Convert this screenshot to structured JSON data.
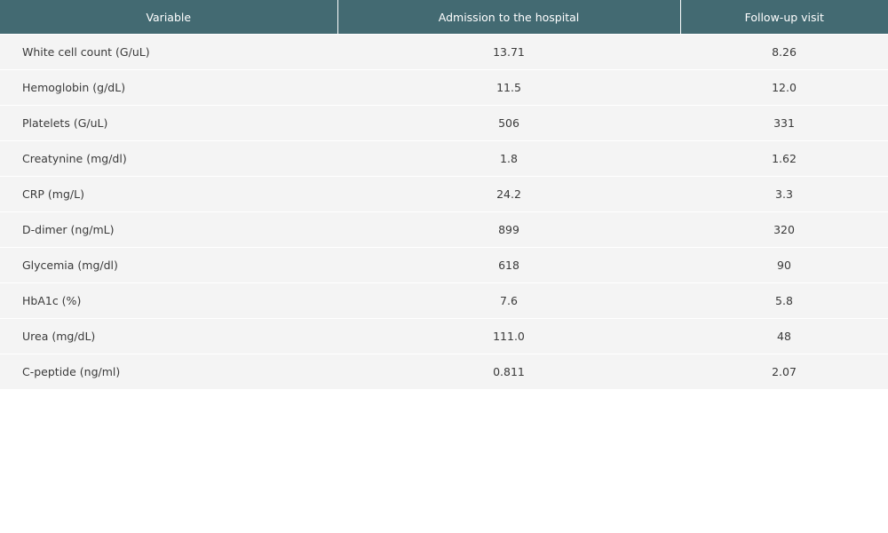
{
  "table": {
    "headers": [
      "Variable",
      "Admission to the hospital",
      "Follow-up visit"
    ],
    "rows": [
      [
        "White cell count (G/uL)",
        "13.71",
        "8.26"
      ],
      [
        "Hemoglobin (g/dL)",
        "11.5",
        "12.0"
      ],
      [
        "Platelets (G/uL)",
        "506",
        "331"
      ],
      [
        "Creatynine (mg/dl)",
        "1.8",
        "1.62"
      ],
      [
        "CRP (mg/L)",
        "24.2",
        "3.3"
      ],
      [
        "D-dimer (ng/mL)",
        "899",
        "320"
      ],
      [
        "Glycemia (mg/dl)",
        "618",
        "90"
      ],
      [
        "HbA1c (%)",
        "7.6",
        "5.8"
      ],
      [
        "Urea (mg/dL)",
        "111.0",
        "48"
      ],
      [
        "C-peptide (ng/ml)",
        "0.811",
        "2.07"
      ]
    ]
  },
  "colors": {
    "header_bg": "#436a72",
    "header_text": "#ffffff",
    "row_bg": "#f4f4f4"
  }
}
